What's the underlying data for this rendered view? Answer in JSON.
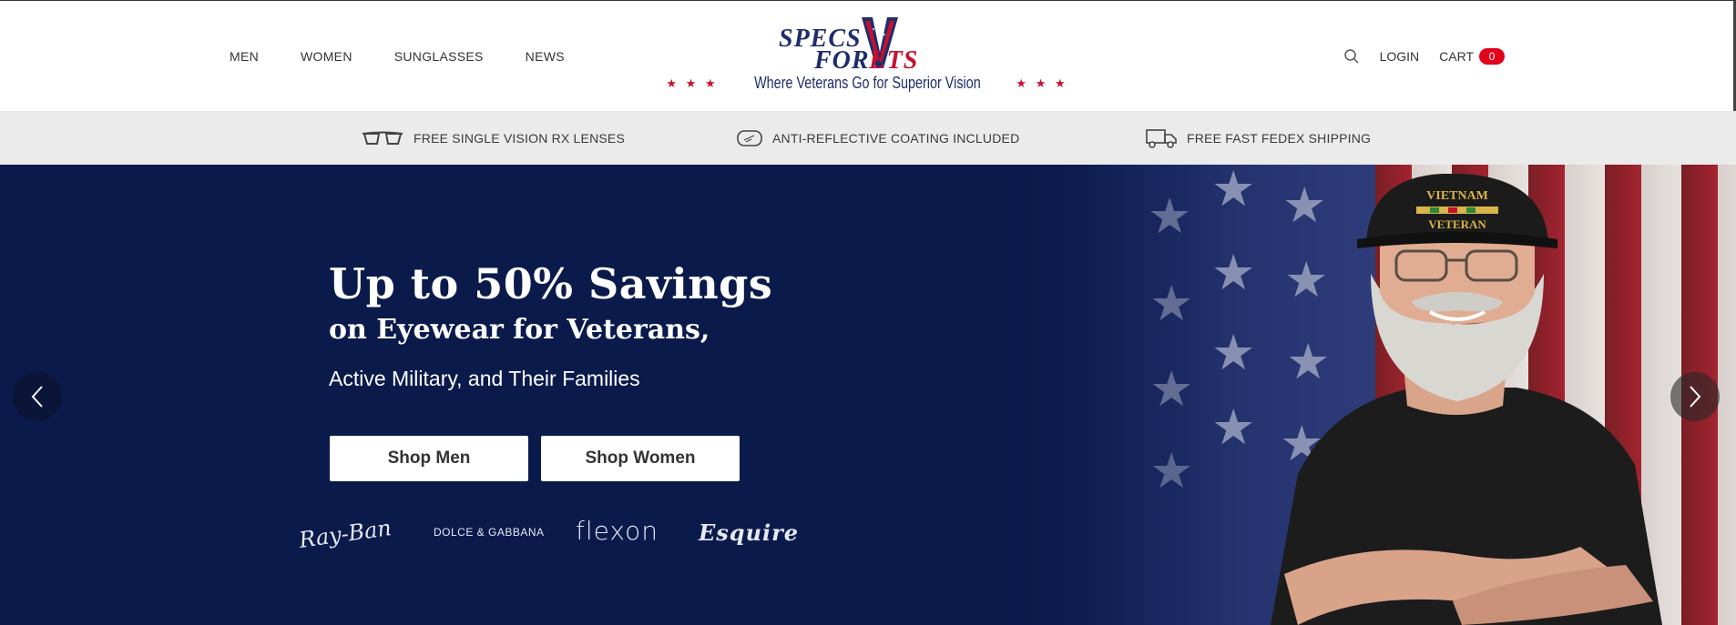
{
  "nav": {
    "items": [
      {
        "label": "MEN"
      },
      {
        "label": "WOMEN"
      },
      {
        "label": "SUNGLASSES"
      },
      {
        "label": "NEWS"
      }
    ]
  },
  "logo": {
    "line1": "SPECS",
    "line2a": "FOR",
    "line2b": "ETS",
    "stars": "★ ★ ★",
    "tagline": "Where Veterans Go for Superior Vision"
  },
  "account": {
    "search_icon": "search-icon",
    "login_label": "LOGIN",
    "cart_label": "CART",
    "cart_count": "0"
  },
  "benefits": [
    {
      "icon": "glasses-icon",
      "label": "FREE SINGLE VISION RX LENSES"
    },
    {
      "icon": "lens-icon",
      "label": "ANTI-REFLECTIVE COATING INCLUDED"
    },
    {
      "icon": "truck-icon",
      "label": "FREE FAST FEDEX SHIPPING"
    }
  ],
  "hero": {
    "title_line1": "Up to 50% Savings",
    "title_line2": "on Eyewear for Veterans,",
    "subtitle": "Active Military, and Their Families",
    "shop_men": "Shop Men",
    "shop_women": "Shop Women",
    "brands": [
      "Ray-Ban",
      "DOLCE & GABBANA",
      "flexon",
      "Esquire"
    ],
    "cap_text_top": "VIETNAM",
    "cap_text_bottom": "VETERAN"
  },
  "colors": {
    "navy": "#0a1a4b",
    "brand_blue": "#1f2d6b",
    "brand_red": "#c8102e",
    "badge_red": "#e0001b"
  }
}
